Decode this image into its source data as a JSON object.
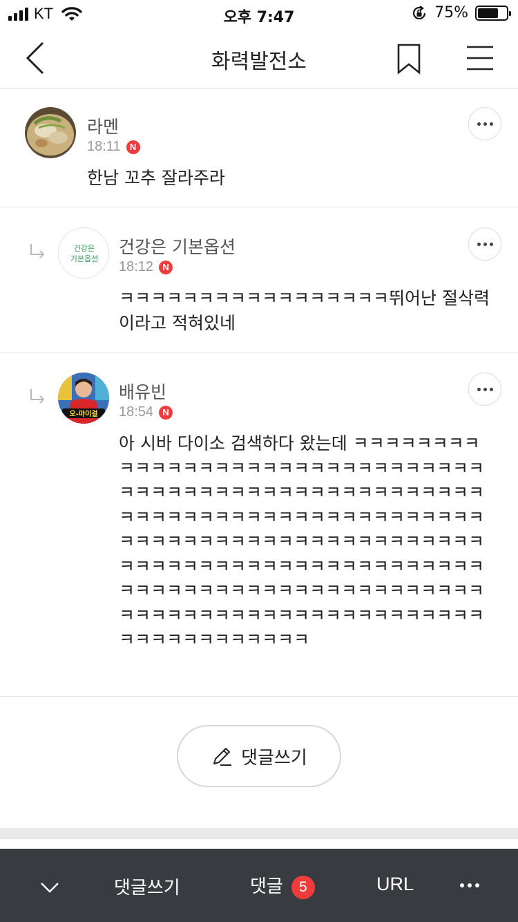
{
  "status_bar": {
    "carrier": "KT",
    "time": "오후 7:47",
    "battery_percent": "75%",
    "battery_level": 0.75
  },
  "nav": {
    "title": "화력발전소"
  },
  "comments": [
    {
      "author": "라멘",
      "time": "18:11",
      "badge": "N",
      "text": "한남 꼬추 잘라주라",
      "is_reply": false
    },
    {
      "author": "건강은 기본옵션",
      "avatar_text_line1": "건강은",
      "avatar_text_line2": "기본옵션",
      "time": "18:12",
      "badge": "N",
      "text": "ㅋㅋㅋㅋㅋㅋㅋㅋㅋㅋㅋㅋㅋㅋㅋㅋㅋ뛰어난 절삭력이라고 적혀있네",
      "is_reply": true
    },
    {
      "author": "배유빈",
      "avatar_caption": "오-마이걸",
      "time": "18:54",
      "badge": "N",
      "text": "아 시바 다이소 검색하다 왔는데 ㅋㅋㅋㅋㅋㅋㅋㅋㅋㅋㅋㅋㅋㅋㅋㅋㅋㅋㅋㅋㅋㅋㅋㅋㅋㅋㅋㅋㅋㅋㅋㅋㅋㅋㅋㅋㅋㅋㅋㅋㅋㅋㅋㅋㅋㅋㅋㅋㅋㅋㅋㅋㅋㅋㅋㅋㅋㅋㅋㅋㅋㅋㅋㅋㅋㅋㅋㅋㅋㅋㅋㅋㅋㅋㅋㅋㅋㅋㅋㅋㅋㅋㅋㅋㅋㅋㅋㅋㅋㅋㅋㅋㅋㅋㅋㅋㅋㅋㅋㅋㅋㅋㅋㅋㅋㅋㅋㅋㅋㅋㅋㅋㅋㅋㅋㅋㅋㅋㅋㅋㅋㅋㅋㅋㅋㅋㅋㅋㅋㅋㅋㅋㅋㅋㅋㅋㅋㅋㅋㅋㅋㅋㅋㅋㅋㅋㅋㅋㅋㅋㅋㅋㅋㅋㅋㅋㅋㅋㅋㅋㅋㅋㅋㅋㅋㅋㅋㅋㅋㅋㅋㅋㅋㅋㅋㅋㅋㅋㅋㅋㅋ",
      "is_reply": true
    }
  ],
  "write_button": {
    "label": "댓글쓰기",
    "icon": "pencil-icon"
  },
  "bottom_bar": {
    "collapse_icon": "chevron-down-icon",
    "write_label": "댓글쓰기",
    "comments_label": "댓글",
    "comments_count": "5",
    "url_label": "URL",
    "more_icon": "more-dots-icon"
  },
  "colors": {
    "badge_red": "#f03c3c",
    "bottom_bar_bg": "#3a3b40",
    "divider": "#e4e4e4",
    "muted_text": "#999999"
  }
}
